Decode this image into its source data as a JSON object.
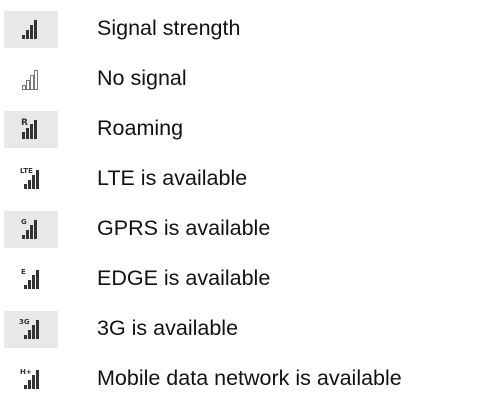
{
  "colors": {
    "icon_fill": "#333333",
    "icon_outline": "#777777",
    "shade": "#e8e8e8"
  },
  "items": [
    {
      "icon": "signal-strength-icon",
      "label": "Signal strength"
    },
    {
      "icon": "no-signal-icon",
      "label": "No signal"
    },
    {
      "icon": "roaming-icon",
      "label": "Roaming",
      "badge": "R"
    },
    {
      "icon": "lte-icon",
      "label": "LTE is available",
      "badge": "LTE"
    },
    {
      "icon": "gprs-icon",
      "label": "GPRS is available",
      "badge": "G"
    },
    {
      "icon": "edge-icon",
      "label": "EDGE is available",
      "badge": "E"
    },
    {
      "icon": "3g-icon",
      "label": "3G is available",
      "badge": "3G"
    },
    {
      "icon": "hsdpa-icon",
      "label": "Mobile data network is available",
      "badge": "H+"
    }
  ]
}
